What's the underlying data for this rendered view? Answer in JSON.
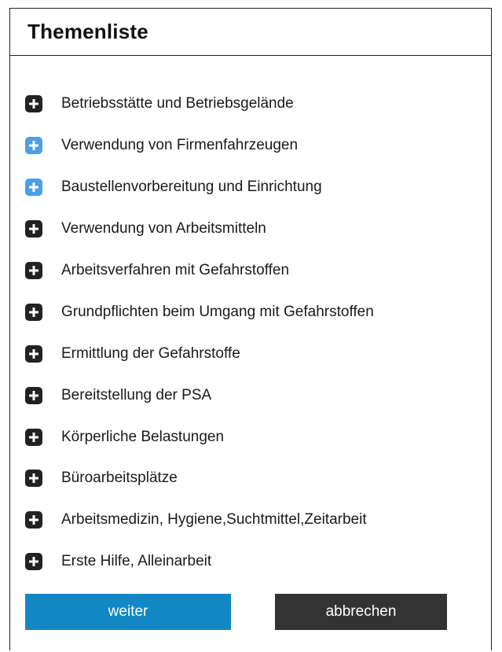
{
  "dialog": {
    "title": "Themenliste"
  },
  "topics": [
    {
      "label": "Betriebsstätte und Betriebsgelände",
      "icon": "plus-icon",
      "icon_color": "#222222"
    },
    {
      "label": "Verwendung von Firmenfahrzeugen",
      "icon": "plus-icon",
      "icon_color": "#4a9fe8"
    },
    {
      "label": "Baustellenvorbereitung und Einrichtung",
      "icon": "plus-icon",
      "icon_color": "#4a9fe8"
    },
    {
      "label": "Verwendung von Arbeitsmitteln",
      "icon": "plus-icon",
      "icon_color": "#222222"
    },
    {
      "label": "Arbeitsverfahren mit Gefahrstoffen",
      "icon": "plus-icon",
      "icon_color": "#222222"
    },
    {
      "label": "Grundpflichten beim Umgang mit Gefahrstoffen",
      "icon": "plus-icon",
      "icon_color": "#222222"
    },
    {
      "label": "Ermittlung der Gefahrstoffe",
      "icon": "plus-icon",
      "icon_color": "#222222"
    },
    {
      "label": "Bereitstellung der PSA",
      "icon": "plus-icon",
      "icon_color": "#222222"
    },
    {
      "label": "Körperliche Belastungen",
      "icon": "plus-icon",
      "icon_color": "#222222"
    },
    {
      "label": "Büroarbeitsplätze",
      "icon": "plus-icon",
      "icon_color": "#222222"
    },
    {
      "label": "Arbeitsmedizin, Hygiene,Suchtmittel,Zeitarbeit",
      "icon": "plus-icon",
      "icon_color": "#222222"
    },
    {
      "label": "Erste Hilfe, Alleinarbeit",
      "icon": "plus-icon",
      "icon_color": "#222222"
    }
  ],
  "buttons": {
    "next_label": "weiter",
    "cancel_label": "abbrechen",
    "next_color": "#1287c4",
    "cancel_color": "#333333"
  }
}
